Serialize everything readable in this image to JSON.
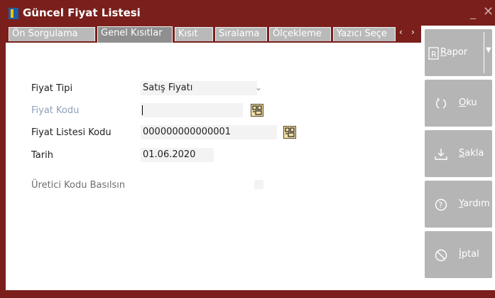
{
  "window": {
    "title": "Güncel Fiyat Listesi",
    "minimize_glyph": "_",
    "close_glyph": "✕"
  },
  "tabs": [
    {
      "label": "Ön Sorgulama",
      "active": false
    },
    {
      "label": "Genel Kısıtlar",
      "active": true
    },
    {
      "label": "Kısıt",
      "active": false
    },
    {
      "label": "Sıralama",
      "active": false
    },
    {
      "label": "Ölçekleme",
      "active": false
    },
    {
      "label": "Yazıcı Seçe",
      "active": false
    }
  ],
  "tab_scroll": {
    "left": "‹",
    "right": "›"
  },
  "form": {
    "fiyat_tipi": {
      "label": "Fiyat Tipi",
      "value": "Satış Fiyatı"
    },
    "fiyat_kodu": {
      "label": "Fiyat Kodu",
      "value": ""
    },
    "fiyat_listesi_kodu": {
      "label": "Fiyat Listesi Kodu",
      "value": "000000000000001"
    },
    "tarih": {
      "label": "Tarih",
      "value": "01.06.2020"
    },
    "uretici_kodu": {
      "label": "Üretici Kodu Basılsın",
      "checked": false
    }
  },
  "actions": {
    "rapor": {
      "hotkey": "R",
      "rest": "apor",
      "icon": "report-icon"
    },
    "oku": {
      "hotkey": "O",
      "rest": "ku",
      "icon": "refresh-icon"
    },
    "sakla": {
      "hotkey": "S",
      "rest": "akla",
      "icon": "download-icon"
    },
    "yardim": {
      "hotkey": "Y",
      "rest": "ardım",
      "icon": "help-icon"
    },
    "iptal": {
      "hotkey": "İ",
      "rest": "ptal",
      "icon": "cancel-icon"
    }
  },
  "colors": {
    "frame": "#7a1f1c",
    "button": "#b5b5b5",
    "field": "#f3f3f3",
    "disabled_label": "#8fa0b7"
  }
}
